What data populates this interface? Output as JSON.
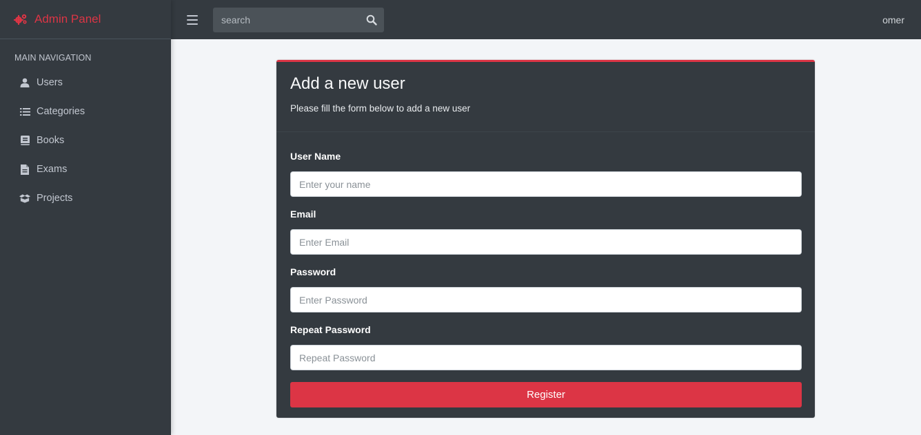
{
  "brand": {
    "title": "Admin Panel",
    "icon": "cogs-icon",
    "color": "#dc3545"
  },
  "sidebar": {
    "header": "MAIN NAVIGATION",
    "items": [
      {
        "label": "Users",
        "icon": "user-icon"
      },
      {
        "label": "Categories",
        "icon": "list-icon"
      },
      {
        "label": "Books",
        "icon": "book-icon"
      },
      {
        "label": "Exams",
        "icon": "file-icon"
      },
      {
        "label": "Projects",
        "icon": "box-icon"
      }
    ]
  },
  "topbar": {
    "search_placeholder": "search",
    "user": "omer"
  },
  "card": {
    "title": "Add a new user",
    "subtitle": "Please fill the form below to add a new user",
    "fields": [
      {
        "label": "User Name",
        "placeholder": "Enter your name"
      },
      {
        "label": "Email",
        "placeholder": "Enter Email"
      },
      {
        "label": "Password",
        "placeholder": "Enter Password"
      },
      {
        "label": "Repeat Password",
        "placeholder": "Repeat Password"
      }
    ],
    "submit_label": "Register"
  },
  "colors": {
    "sidebar_bg": "#343a40",
    "accent": "#dc3545",
    "content_bg": "#f3f5f8"
  }
}
